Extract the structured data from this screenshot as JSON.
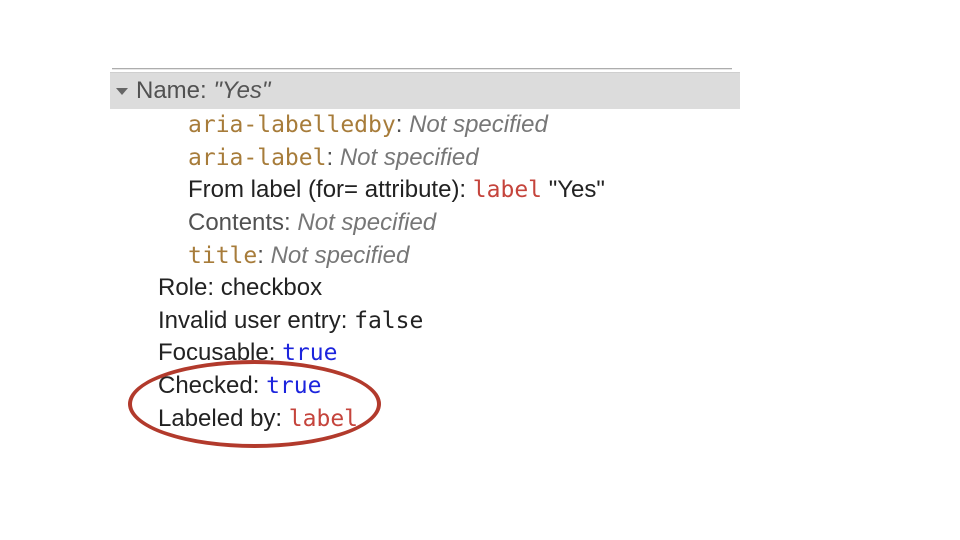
{
  "header": {
    "name_label": "Name:",
    "name_value": "\"Yes\""
  },
  "sources": {
    "aria_labelledby": {
      "attr": "aria-labelledby",
      "value": "Not specified"
    },
    "aria_label": {
      "attr": "aria-label",
      "value": "Not specified"
    },
    "from_label": {
      "label": "From label (for= attribute):",
      "code": "label",
      "text": "\"Yes\""
    },
    "contents": {
      "label": "Contents:",
      "value": "Not specified"
    },
    "title": {
      "attr": "title",
      "value": "Not specified"
    }
  },
  "props": {
    "role": {
      "label": "Role:",
      "value": "checkbox"
    },
    "invalid": {
      "label": "Invalid user entry:",
      "value": "false"
    },
    "focusable": {
      "label": "Focusable:",
      "value": "true"
    },
    "checked": {
      "label": "Checked:",
      "value": "true"
    },
    "labeled_by": {
      "label": "Labeled by:",
      "value": "label"
    }
  }
}
